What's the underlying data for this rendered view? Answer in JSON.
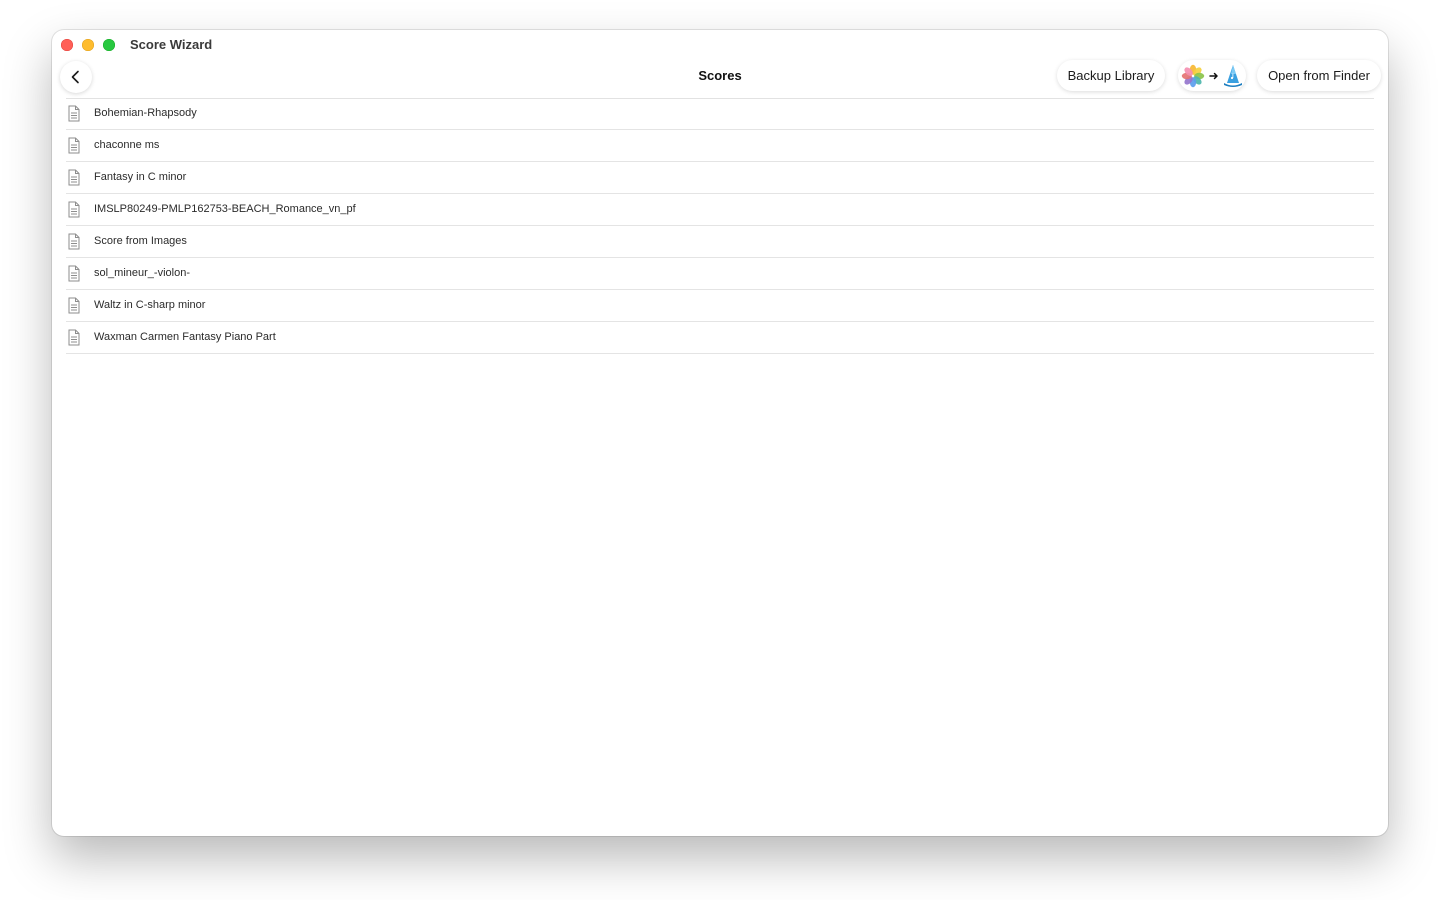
{
  "window": {
    "app_title": "Score Wizard"
  },
  "navbar": {
    "title": "Scores",
    "back_icon": "chevron-left-icon",
    "buttons": {
      "backup_label": "Backup Library",
      "import_photos_icons": [
        "photos-icon",
        "arrow-right-icon",
        "score-wizard-icon"
      ],
      "open_finder_label": "Open from Finder"
    }
  },
  "scores": [
    {
      "name": "Bohemian-Rhapsody",
      "icon": "document-icon"
    },
    {
      "name": "chaconne ms",
      "icon": "document-icon"
    },
    {
      "name": "Fantasy in C minor",
      "icon": "document-icon"
    },
    {
      "name": "IMSLP80249-PMLP162753-BEACH_Romance_vn_pf",
      "icon": "document-icon"
    },
    {
      "name": "Score from Images",
      "icon": "document-icon"
    },
    {
      "name": "sol_mineur_-violon-",
      "icon": "document-icon"
    },
    {
      "name": "Waltz in C-sharp minor",
      "icon": "document-icon"
    },
    {
      "name": "Waxman Carmen Fantasy Piano Part",
      "icon": "document-icon"
    }
  ],
  "colors": {
    "traffic_close": "#ff5f57",
    "traffic_minimize": "#febc2e",
    "traffic_maximize": "#28c840",
    "divider": "#e4e4e4",
    "text": "#2b2b2b"
  }
}
